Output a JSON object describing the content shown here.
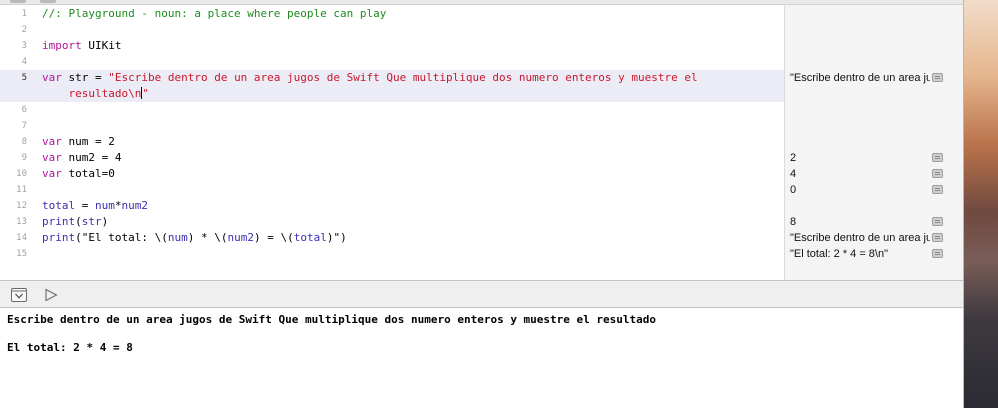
{
  "editor": {
    "lines": [
      {
        "n": "1",
        "parts": [
          {
            "t": "//: Playground - noun: a place where people can play",
            "c": "cm"
          }
        ]
      },
      {
        "n": "2",
        "parts": []
      },
      {
        "n": "3",
        "parts": [
          {
            "t": "import",
            "c": "kw"
          },
          {
            "t": " UIKit",
            "c": ""
          }
        ]
      },
      {
        "n": "4",
        "parts": []
      },
      {
        "n": "5",
        "active": true,
        "parts": [
          {
            "t": "var",
            "c": "kw"
          },
          {
            "t": " str = ",
            "c": ""
          },
          {
            "t": "\"Escribe dentro de un area jugos de Swift Que multiplique dos numero enteros y muestre el",
            "c": "st"
          }
        ],
        "cont": [
          {
            "t": "    resultado\\n",
            "c": "st"
          },
          {
            "t": "|",
            "c": "cursor"
          },
          {
            "t": "\"",
            "c": "st"
          }
        ]
      },
      {
        "n": "6",
        "parts": []
      },
      {
        "n": "7",
        "parts": []
      },
      {
        "n": "8",
        "parts": [
          {
            "t": "var",
            "c": "kw"
          },
          {
            "t": " num = 2",
            "c": ""
          }
        ]
      },
      {
        "n": "9",
        "parts": [
          {
            "t": "var",
            "c": "kw"
          },
          {
            "t": " num2 = 4",
            "c": ""
          }
        ]
      },
      {
        "n": "10",
        "parts": [
          {
            "t": "var",
            "c": "kw"
          },
          {
            "t": " total=0",
            "c": ""
          }
        ]
      },
      {
        "n": "11",
        "parts": []
      },
      {
        "n": "12",
        "parts": [
          {
            "t": "total",
            "c": "id"
          },
          {
            "t": " = ",
            "c": ""
          },
          {
            "t": "num",
            "c": "id"
          },
          {
            "t": "*",
            "c": ""
          },
          {
            "t": "num2",
            "c": "id"
          }
        ]
      },
      {
        "n": "13",
        "parts": [
          {
            "t": "print",
            "c": "id"
          },
          {
            "t": "(",
            "c": ""
          },
          {
            "t": "str",
            "c": "id"
          },
          {
            "t": ")",
            "c": ""
          }
        ]
      },
      {
        "n": "14",
        "parts": [
          {
            "t": "print",
            "c": "id"
          },
          {
            "t": "(",
            "c": ""
          },
          {
            "t": "\"El total: \\(",
            "c": ""
          },
          {
            "t": "num",
            "c": "id"
          },
          {
            "t": ") * \\(",
            "c": ""
          },
          {
            "t": "num2",
            "c": "id"
          },
          {
            "t": ") = \\(",
            "c": ""
          },
          {
            "t": "total",
            "c": "id"
          },
          {
            "t": ")\")",
            "c": ""
          }
        ]
      },
      {
        "n": "15",
        "parts": []
      }
    ]
  },
  "results": [
    {
      "slot": 4,
      "value": "\"Escribe dentro de un area jugos de Swift Que multiplique dos numero enteros y muestre el resultado\\n\""
    },
    {
      "slot": 8,
      "value": "2"
    },
    {
      "slot": 9,
      "value": "4"
    },
    {
      "slot": 10,
      "value": "0"
    },
    {
      "slot": 12,
      "value": "8"
    },
    {
      "slot": 13,
      "value": "\"Escribe dentro de un area jugos de Swift Que multiplique dos numero enteros y muestre el resultado\\n\""
    },
    {
      "slot": 14,
      "value": "\"El total: 2 * 4 = 8\\n\""
    }
  ],
  "console": {
    "lines": [
      "Escribe dentro de un area jugos de Swift Que multiplique dos numero enteros y muestre el resultado",
      "",
      "El total: 2 * 4 = 8"
    ]
  }
}
